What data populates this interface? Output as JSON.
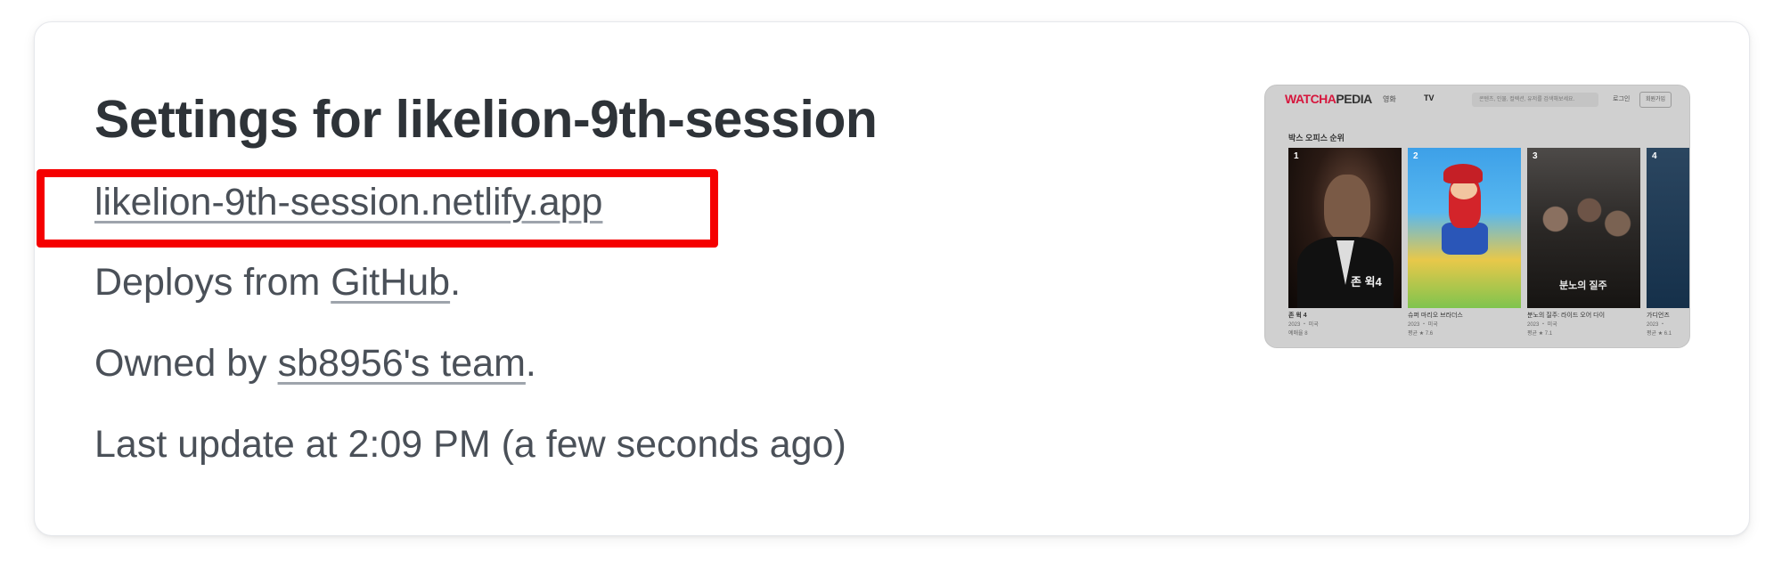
{
  "page": {
    "title": "Settings for likelion-9th-session",
    "site_url": "likelion-9th-session.netlify.app",
    "deploys_prefix": "Deploys from ",
    "deploys_link": "GitHub",
    "deploys_suffix": ".",
    "owned_prefix": "Owned by ",
    "owned_link": "sb8956's team",
    "owned_suffix": ".",
    "last_update": "Last update at 2:09 PM (a few seconds ago)"
  },
  "colors": {
    "highlight_border": "#f50000",
    "text": "#4a5058",
    "title": "#2e3338"
  },
  "preview": {
    "logo_main": "WATCHA",
    "logo_sub": "PEDIA",
    "nav_movies": "영화",
    "nav_tv": "TV",
    "search_placeholder": "콘텐츠, 인물, 컬렉션, 유저를 검색해보세요.",
    "login": "로그인",
    "signup": "회원가입",
    "section_title": "박스 오피스 순위",
    "items": [
      {
        "rank": "1",
        "poster_text": "존 윅4",
        "title": "존 윅 4",
        "meta": "2023 ・ 미국",
        "stat": "예매율 8"
      },
      {
        "rank": "2",
        "poster_text": "",
        "title": "슈퍼 마리오 브라더스",
        "meta": "2023 ・ 미국",
        "stat": "평균 ★ 7.6"
      },
      {
        "rank": "3",
        "poster_text": "분노의 질주",
        "title": "분노의 질주: 라이드 오어 다이",
        "meta": "2023 ・ 미국",
        "stat": "평균 ★ 7.1"
      },
      {
        "rank": "4",
        "poster_text": "",
        "title": "가디언즈",
        "meta": "2023 ・",
        "stat": "평균 ★ 6.1"
      }
    ]
  }
}
